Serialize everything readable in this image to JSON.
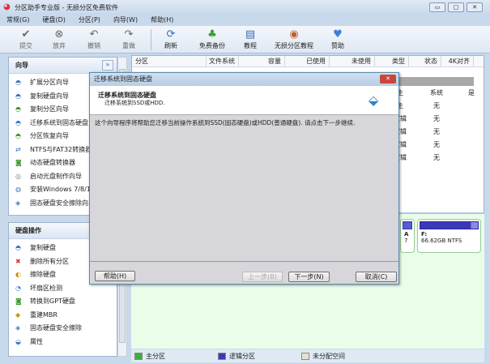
{
  "window": {
    "title": "分区助手专业版 - 无损分区免费软件",
    "min": "▭",
    "max": "□",
    "close": "✕"
  },
  "menu": [
    "常规(G)",
    "硬盘(D)",
    "分区(P)",
    "向导(W)",
    "帮助(H)"
  ],
  "toolbar": [
    {
      "label": "提交",
      "icon": "✔",
      "disabled": true
    },
    {
      "label": "放弃",
      "icon": "⊗",
      "disabled": true
    },
    {
      "label": "撤销",
      "icon": "↶",
      "disabled": true
    },
    {
      "label": "重做",
      "icon": "↷",
      "disabled": true
    },
    {
      "label": "刷新",
      "icon": "⟳"
    },
    {
      "label": "免费备份",
      "icon": "♣"
    },
    {
      "label": "教程",
      "icon": "▤"
    },
    {
      "label": "无损分区教程",
      "icon": "◉"
    },
    {
      "label": "赞助",
      "icon": "♥"
    }
  ],
  "wizard_panel": {
    "title": "向导",
    "collapse": "»",
    "items": [
      "扩展分区向导",
      "复制硬盘向导",
      "复制分区向导",
      "迁移系统到固态硬盘",
      "分区恢复向导",
      "NTFS与FAT32转换器",
      "动态硬盘转换器",
      "启动光盘制作向导",
      "安装Windows 7/8/10到USB",
      "固态硬盘安全擦除向导"
    ]
  },
  "disk_panel": {
    "title": "硬盘操作",
    "items": [
      "复制硬盘",
      "删除所有分区",
      "擦除硬盘",
      "坏扇区检测",
      "转换到GPT硬盘",
      "重建MBR",
      "固态硬盘安全擦除",
      "属性"
    ]
  },
  "table": {
    "headers": [
      "分区",
      "文件系统",
      "容量",
      "已使用",
      "未使用",
      "类型",
      "状态",
      "4K对齐"
    ],
    "rows": [
      {
        "type": "主",
        "status": "系统",
        "align": "是"
      },
      {
        "type": "主",
        "status": "无",
        "align": ""
      },
      {
        "type": "逻辑",
        "status": "无",
        "align": ""
      },
      {
        "type": "逻辑",
        "status": "无",
        "align": ""
      },
      {
        "type": "逻辑",
        "status": "无",
        "align": ""
      },
      {
        "type": "逻辑",
        "status": "无",
        "align": ""
      }
    ]
  },
  "disk_map": {
    "small_label": "A",
    "small_sub": "7",
    "partition_name": "F:",
    "partition_info": "66.62GB NTFS"
  },
  "legend": [
    "主分区",
    "逻辑分区",
    "未分配空间"
  ],
  "colors": {
    "primary": "#3cb03c",
    "logical": "#3a3ab8",
    "unallocated": "#e8e0d0"
  },
  "dialog": {
    "title": "迁移系统到固态硬盘",
    "heading": "迁移系统到固态硬盘",
    "subheading": "迁移系统到SSD或HDD.",
    "body": "这个向导程序将帮助您迁移当前操作系统到SSD(固态硬盘)或HDD(普通硬盘). 请点击下一步继续.",
    "help": "帮助(H)",
    "back": "上一步(B)",
    "next": "下一步(N)",
    "cancel": "取消(C)",
    "close": "✕"
  }
}
